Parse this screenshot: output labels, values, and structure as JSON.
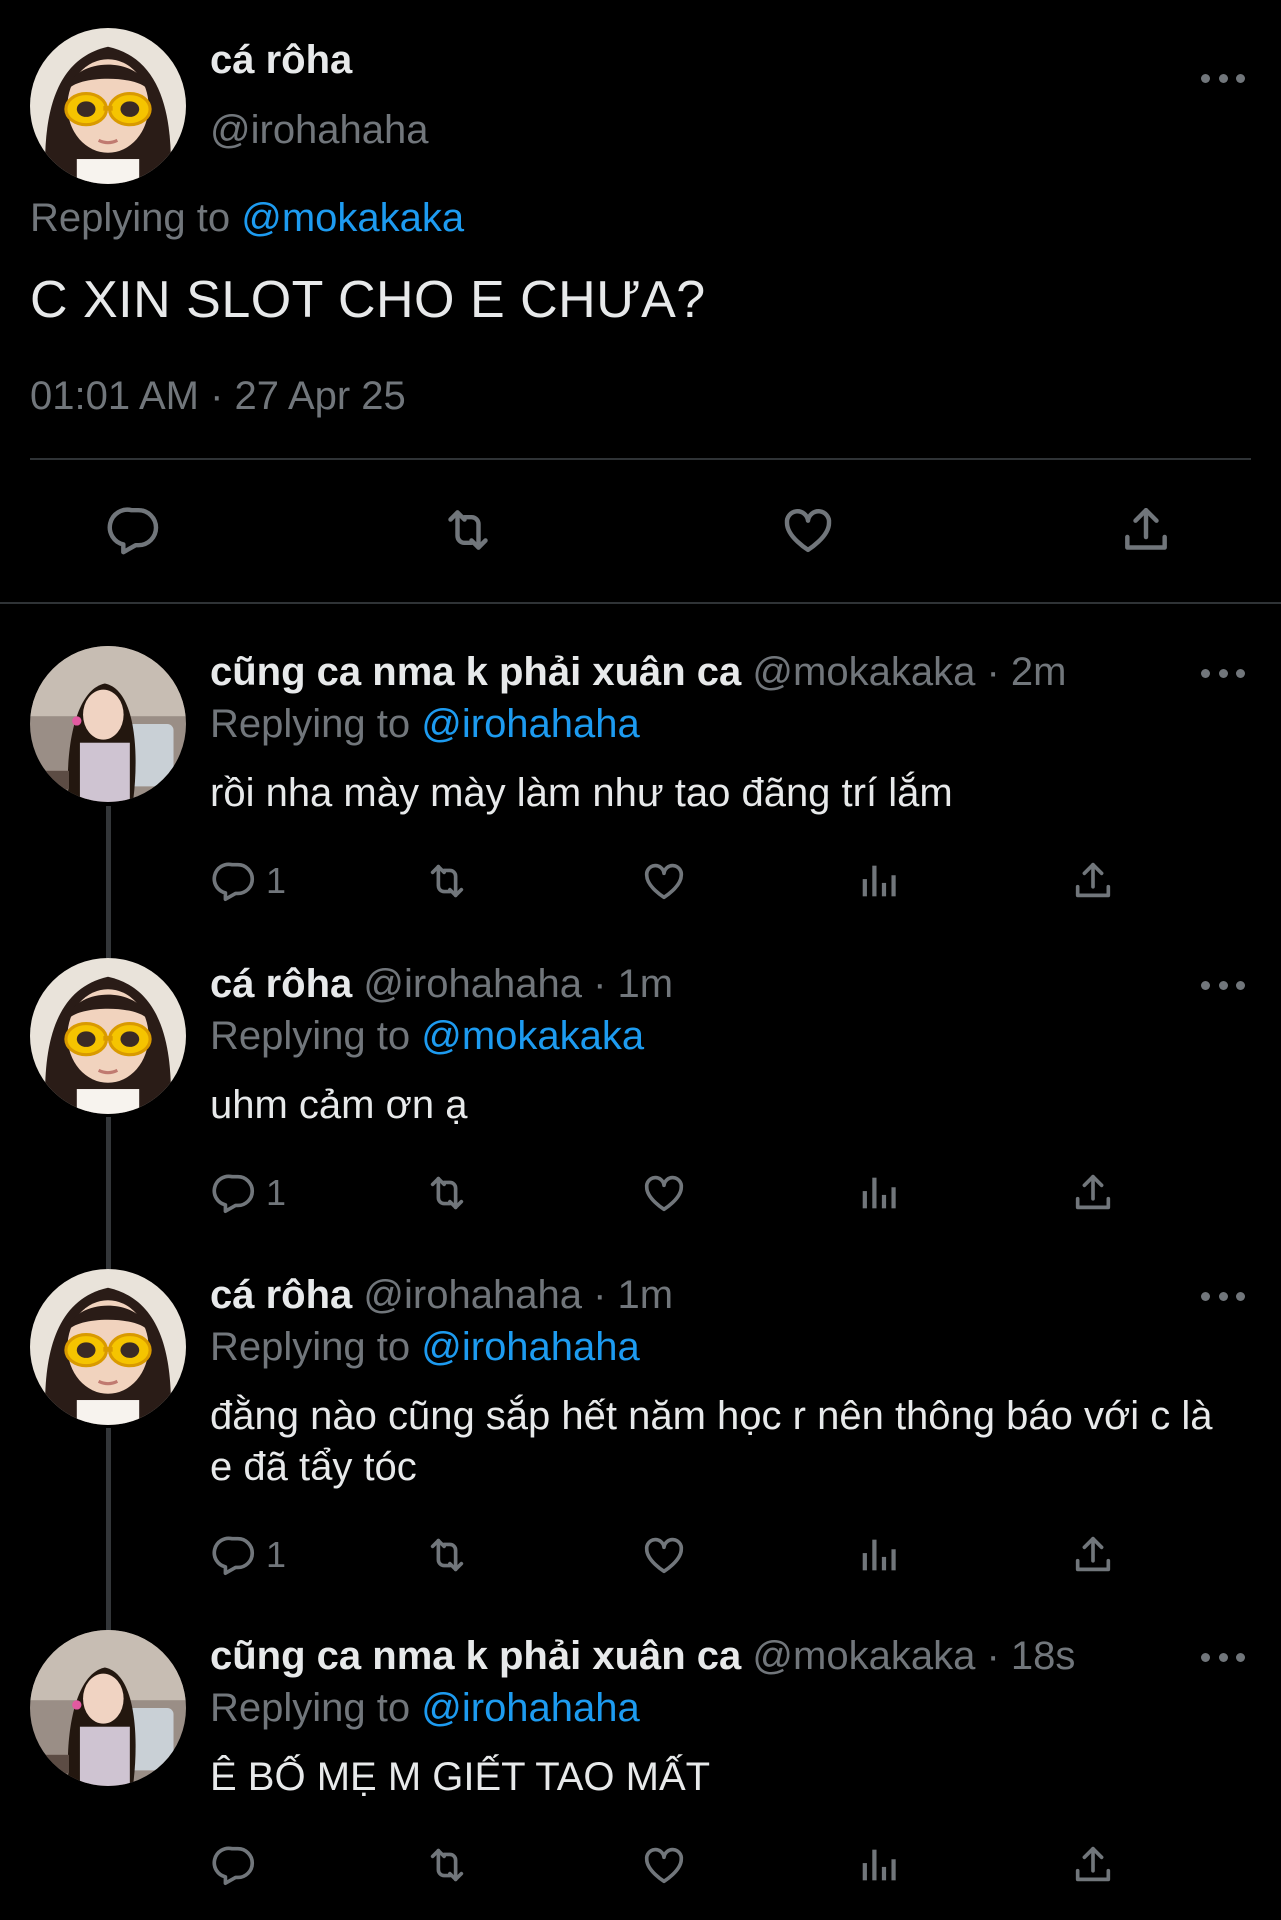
{
  "main_tweet": {
    "name": "cá rôha",
    "handle": "@irohahaha",
    "replying_label": "Replying to",
    "replying_to": "@mokakaka",
    "text": "C XIN SLOT CHO E CHƯA?",
    "timestamp": "01:01 AM · 27 Apr 25",
    "actions": [
      "reply-icon",
      "retweet-icon",
      "like-icon",
      "share-icon"
    ]
  },
  "replies": [
    {
      "name": "cũng ca nma k phải xuân ca",
      "handle": "@mokakaka",
      "time": "2m",
      "replying_label": "Replying to",
      "replying_to": "@irohahaha",
      "text": "rồi nha mày mày làm như tao đãng trí lắm",
      "reply_count": "1"
    },
    {
      "name": "cá rôha",
      "handle": "@irohahaha",
      "time": "1m",
      "replying_label": "Replying to",
      "replying_to": "@mokakaka",
      "text": "uhm cảm ơn ạ",
      "reply_count": "1"
    },
    {
      "name": "cá rôha",
      "handle": "@irohahaha",
      "time": "1m",
      "replying_label": "Replying to",
      "replying_to": "@irohahaha",
      "text": "đằng nào cũng sắp hết năm học r nên thông báo với c là e đã tẩy tóc",
      "reply_count": "1"
    },
    {
      "name": "cũng ca nma k phải xuân ca",
      "handle": "@mokakaka",
      "time": "18s",
      "replying_label": "Replying to",
      "replying_to": "@irohahaha",
      "text": "Ê BỐ MẸ M GIẾT TAO MẤT",
      "reply_count": ""
    }
  ],
  "colors": {
    "background": "#000000",
    "text": "#e7e9ea",
    "secondary": "#71767b",
    "link": "#1d9bf0",
    "divider": "#2f3336"
  }
}
